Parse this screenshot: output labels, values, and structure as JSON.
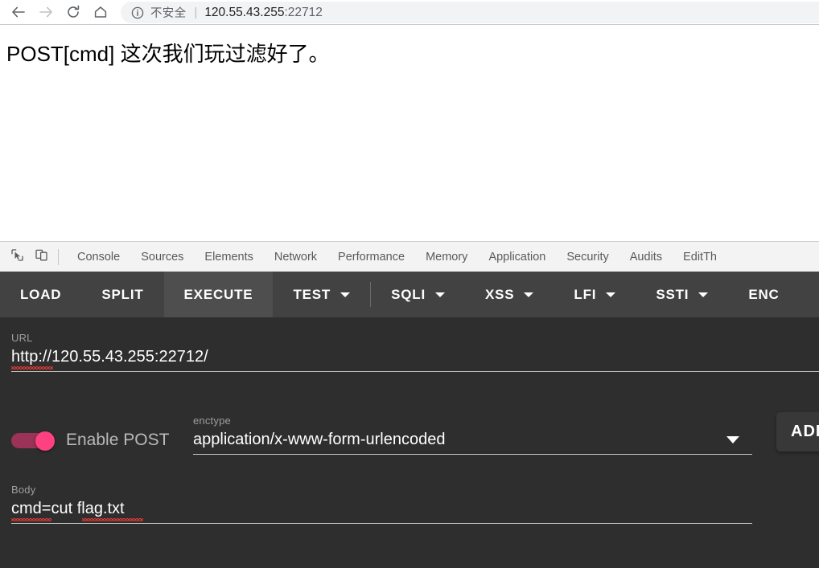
{
  "browser": {
    "nav": {
      "back": "back-arrow",
      "forward": "forward-arrow",
      "reload": "reload",
      "home": "home"
    },
    "omnibox": {
      "info_icon": "info-circle-icon",
      "security_text": "不安全",
      "separator": "|",
      "url_host": "120.55.43.255",
      "url_port": ":22712",
      "url_full": "120.55.43.255:22712"
    }
  },
  "page": {
    "content": "POST[cmd] 这次我们玩过滤好了。"
  },
  "devtools": {
    "inspect_icon": "inspect-element-icon",
    "device_icon": "device-toolbar-icon",
    "tabs": [
      {
        "label": "Console"
      },
      {
        "label": "Sources"
      },
      {
        "label": "Elements"
      },
      {
        "label": "Network"
      },
      {
        "label": "Performance"
      },
      {
        "label": "Memory"
      },
      {
        "label": "Application"
      },
      {
        "label": "Security"
      },
      {
        "label": "Audits"
      },
      {
        "label": "EditTh"
      }
    ]
  },
  "panel": {
    "toolbar": [
      {
        "label": "LOAD",
        "dropdown": false,
        "active": false
      },
      {
        "label": "SPLIT",
        "dropdown": false,
        "active": false
      },
      {
        "label": "EXECUTE",
        "dropdown": false,
        "active": true
      },
      {
        "label": "TEST",
        "dropdown": true,
        "active": false
      },
      {
        "label": "SQLI",
        "dropdown": true,
        "active": false
      },
      {
        "label": "XSS",
        "dropdown": true,
        "active": false
      },
      {
        "label": "LFI",
        "dropdown": true,
        "active": false
      },
      {
        "label": "SSTI",
        "dropdown": true,
        "active": false
      },
      {
        "label": "ENC",
        "dropdown": false,
        "active": false
      }
    ],
    "url": {
      "label": "URL",
      "value": "http://120.55.43.255:22712/"
    },
    "post_toggle": {
      "label": "Enable POST",
      "enabled": true,
      "track_color": "#9b3358",
      "knob_color": "#ff4081"
    },
    "enctype": {
      "label": "enctype",
      "value": "application/x-www-form-urlencoded"
    },
    "add_button": {
      "label": "ADD"
    },
    "body": {
      "label": "Body",
      "value": "cmd=cut flag.txt"
    }
  },
  "colors": {
    "panel_bg": "#2e2e2e",
    "toolbar_bg": "#424242",
    "active_tab_bg": "#4e4e4e",
    "accent_pink": "#ff4081",
    "spellcheck_red": "#e53935"
  }
}
